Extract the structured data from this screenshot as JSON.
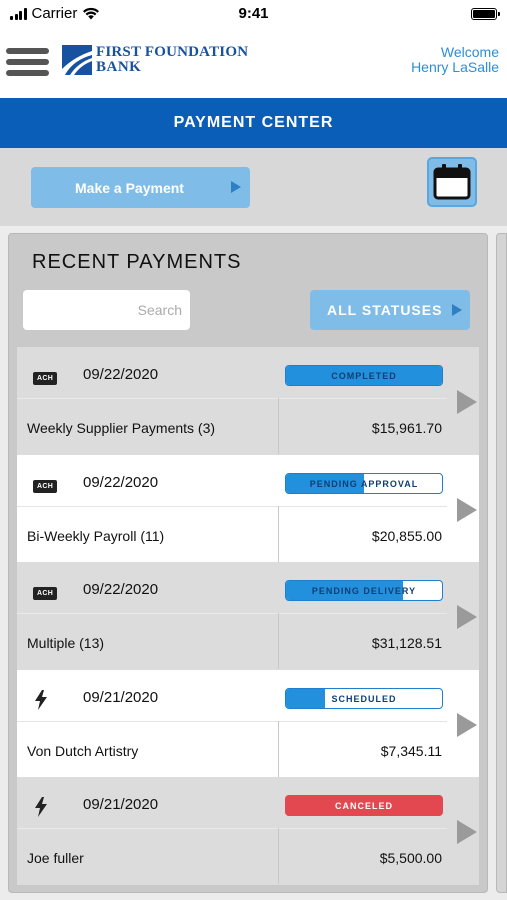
{
  "status_bar": {
    "carrier": "Carrier",
    "time": "9:41"
  },
  "header": {
    "logo_line1": "FIRST FOUNDATION",
    "logo_line2": "BANK",
    "welcome": "Welcome",
    "user_name": "Henry LaSalle"
  },
  "title": "PAYMENT CENTER",
  "actions": {
    "make_payment_label": "Make a Payment"
  },
  "recent": {
    "heading": "RECENT PAYMENTS",
    "search_placeholder": "Search",
    "filter_label": "ALL STATUSES"
  },
  "colors": {
    "brand_blue": "#0b5eb8",
    "button_blue": "#7fbde8",
    "progress_blue": "#2390dd",
    "canceled_red": "#e3474f"
  },
  "payments": [
    {
      "type_icon": "ach-icon",
      "type_label": "ACH",
      "date": "09/22/2020",
      "status": "COMPLETED",
      "progress": 1.0,
      "description": "Weekly Supplier Payments (3)",
      "amount": "$15,961.70"
    },
    {
      "type_icon": "ach-icon",
      "type_label": "ACH",
      "date": "09/22/2020",
      "status": "PENDING APPROVAL",
      "progress": 0.5,
      "description": "Bi-Weekly Payroll (11)",
      "amount": "$20,855.00"
    },
    {
      "type_icon": "ach-icon",
      "type_label": "ACH",
      "date": "09/22/2020",
      "status": "PENDING DELIVERY",
      "progress": 0.75,
      "description": "Multiple (13)",
      "amount": "$31,128.51"
    },
    {
      "type_icon": "lightning-icon",
      "date": "09/21/2020",
      "status": "SCHEDULED",
      "progress": 0.25,
      "description": "Von Dutch Artistry",
      "amount": "$7,345.11"
    },
    {
      "type_icon": "lightning-icon",
      "date": "09/21/2020",
      "status": "CANCELED",
      "progress": 1.0,
      "description": "Joe fuller",
      "amount": "$5,500.00"
    }
  ]
}
